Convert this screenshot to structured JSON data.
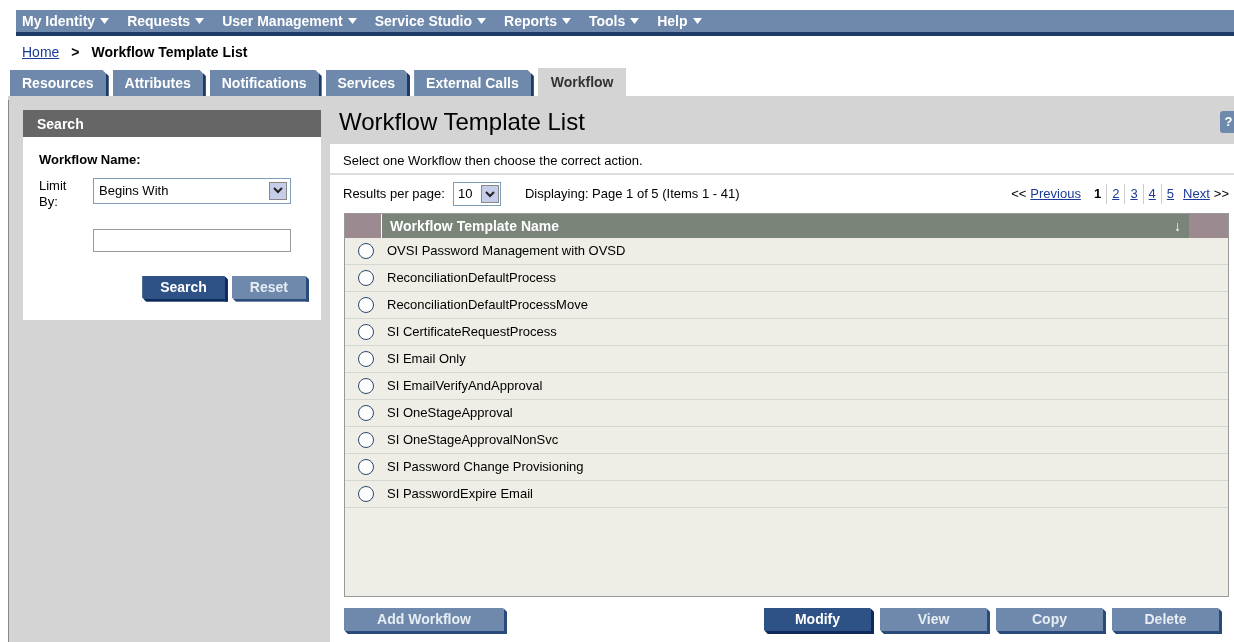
{
  "menu": [
    {
      "label": "My Identity"
    },
    {
      "label": "Requests"
    },
    {
      "label": "User Management"
    },
    {
      "label": "Service Studio"
    },
    {
      "label": "Reports"
    },
    {
      "label": "Tools"
    },
    {
      "label": "Help"
    }
  ],
  "breadcrumb": {
    "home": "Home",
    "separator": ">",
    "current": "Workflow Template List"
  },
  "tabs": [
    {
      "label": "Resources",
      "selected": false
    },
    {
      "label": "Attributes",
      "selected": false
    },
    {
      "label": "Notifications",
      "selected": false
    },
    {
      "label": "Services",
      "selected": false
    },
    {
      "label": "External Calls",
      "selected": false
    },
    {
      "label": "Workflow",
      "selected": true
    }
  ],
  "search": {
    "title": "Search",
    "field_label": "Workflow Name:",
    "limit_label": "Limit By:",
    "limit_value": "Begins With",
    "buttons": [
      {
        "label": "Search",
        "kind": "primary"
      },
      {
        "label": "Reset",
        "kind": "secondary"
      }
    ]
  },
  "page": {
    "title": "Workflow Template List",
    "help": "?",
    "instruction": "Select one Workflow then choose the correct action."
  },
  "results": {
    "per_page_label": "Results per page:",
    "per_page": "10",
    "displaying": "Displaying: Page 1 of 5 (Items 1 - 41)"
  },
  "pager": {
    "start": "<<",
    "previous": "Previous",
    "pages": [
      {
        "label": "1",
        "selected": true
      },
      {
        "label": "2",
        "selected": false
      },
      {
        "label": "3",
        "selected": false
      },
      {
        "label": "4",
        "selected": false
      },
      {
        "label": "5",
        "selected": false
      }
    ],
    "next": "Next",
    "end": ">>"
  },
  "table": {
    "column": "Workflow Template Name",
    "sort": "↓",
    "rows": [
      {
        "name": "OVSI Password Management with OVSD",
        "selected": false
      },
      {
        "name": "ReconciliationDefaultProcess",
        "selected": false
      },
      {
        "name": "ReconciliationDefaultProcessMove",
        "selected": false
      },
      {
        "name": "SI CertificateRequestProcess",
        "selected": false
      },
      {
        "name": "SI Email Only",
        "selected": false
      },
      {
        "name": "SI EmailVerifyAndApproval",
        "selected": false
      },
      {
        "name": "SI OneStageApproval",
        "selected": false
      },
      {
        "name": "SI OneStageApprovalNonSvc",
        "selected": false
      },
      {
        "name": "SI Password Change Provisioning",
        "selected": false
      },
      {
        "name": "SI PasswordExpire Email",
        "selected": false
      }
    ]
  },
  "actions": {
    "left": [
      {
        "label": "Add Workflow",
        "kind": "secondary"
      }
    ],
    "right": [
      {
        "label": "Modify",
        "kind": "primary"
      },
      {
        "label": "View",
        "kind": "secondary"
      },
      {
        "label": "Copy",
        "kind": "secondary"
      },
      {
        "label": "Delete",
        "kind": "secondary"
      }
    ]
  }
}
